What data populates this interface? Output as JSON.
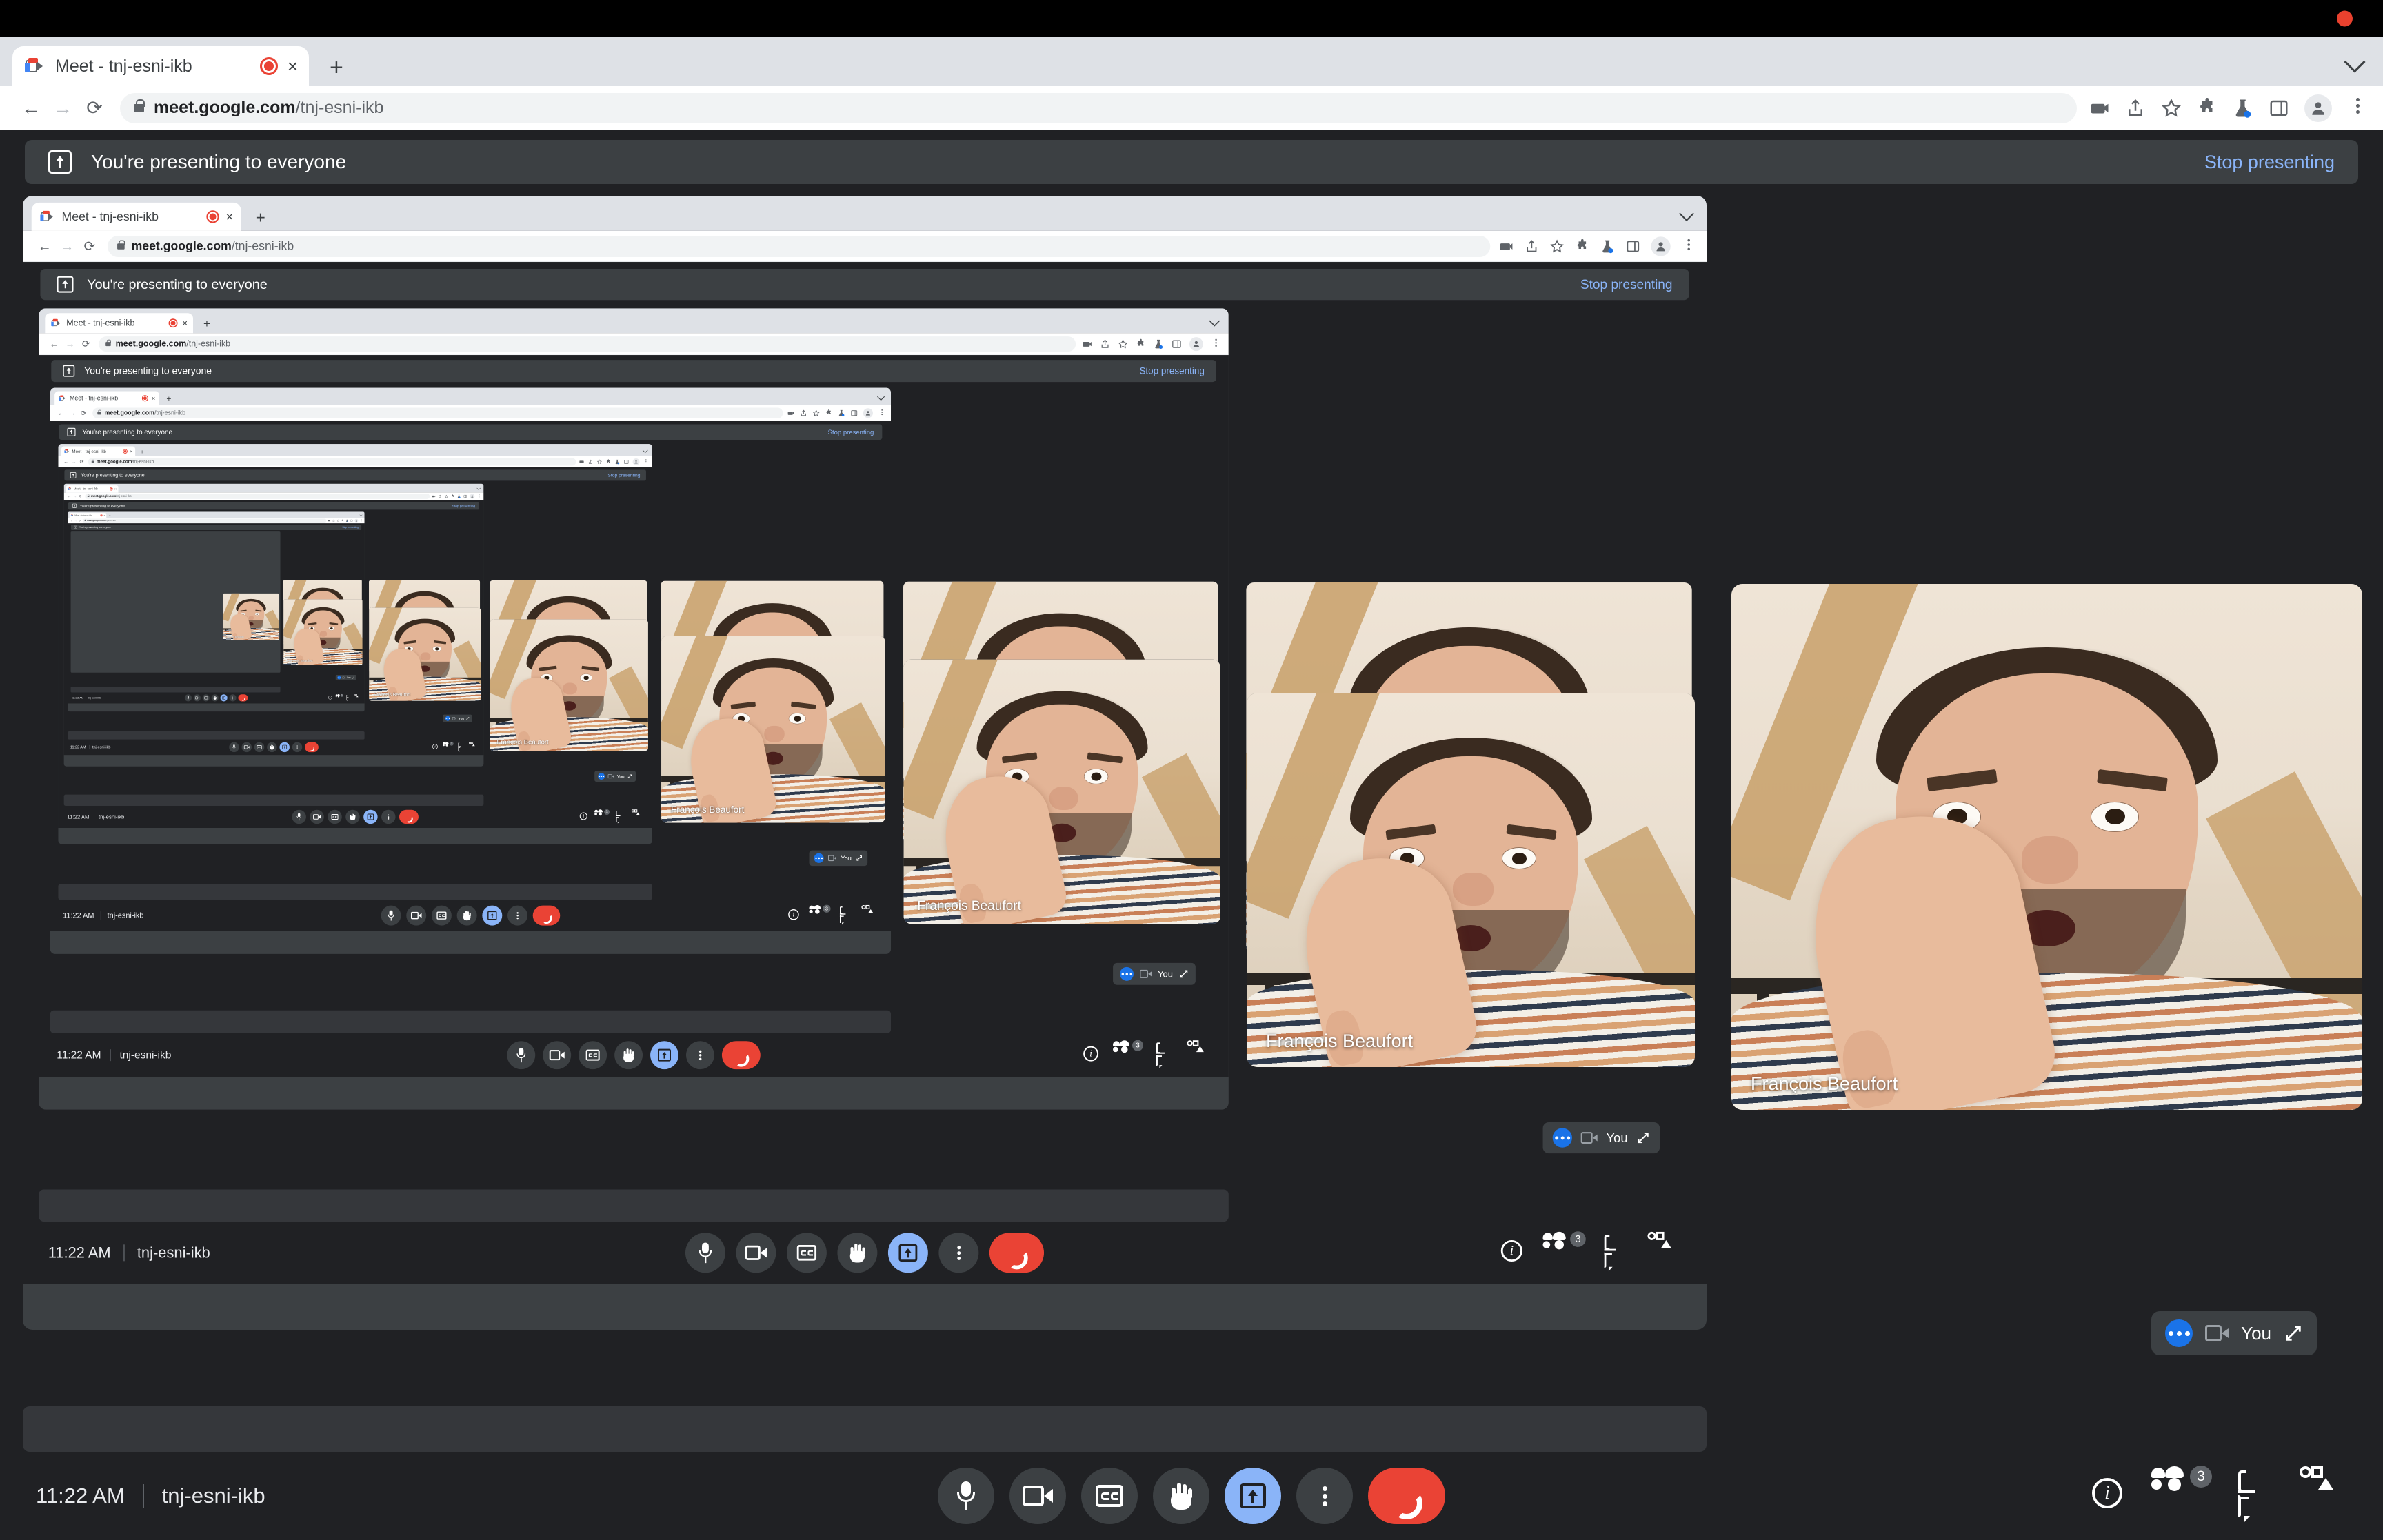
{
  "os": {
    "recording_indicator": "recording-dot",
    "accent_red": "#e8412e"
  },
  "browser": {
    "tab_title": "Meet - tnj-esni-ikb",
    "tab_recording_icon": "record-dot-icon",
    "tab_close_label": "×",
    "new_tab_label": "+",
    "favicon": "google-meet-icon",
    "back_label": "←",
    "forward_label": "→",
    "reload_label": "⟳",
    "lock_icon": "lock-icon",
    "url_domain": "meet.google.com",
    "url_path": "/tnj-esni-ikb",
    "toolbar_icons": [
      "media-cast-icon",
      "share-icon",
      "bookmark-star-icon",
      "extensions-puzzle-icon",
      "lab-flask-icon",
      "side-panel-icon",
      "profile-avatar-icon",
      "chrome-menu-icon"
    ],
    "tabstrip_chevron": "chevron-down-icon"
  },
  "meet": {
    "banner": {
      "icon": "present-screen-icon",
      "text": "You're presenting to everyone",
      "stop_label": "Stop presenting",
      "stop_color": "#8ab4f8"
    },
    "participant_name": "François Beaufort",
    "self_view": {
      "status_icon": "more-dots-icon",
      "camera_icon": "camera-icon",
      "label": "You",
      "expand_icon": "expand-icon"
    },
    "controls": {
      "time": "11:22 AM",
      "meeting_code": "tnj-esni-ikb",
      "buttons": [
        {
          "name": "microphone-button",
          "icon": "mic-icon",
          "state": "on"
        },
        {
          "name": "camera-button",
          "icon": "camera-icon",
          "state": "on"
        },
        {
          "name": "captions-button",
          "icon": "cc-icon",
          "state": "off"
        },
        {
          "name": "raise-hand-button",
          "icon": "hand-icon",
          "state": "off"
        },
        {
          "name": "present-now-button",
          "icon": "present-screen-icon",
          "state": "active"
        },
        {
          "name": "more-options-button",
          "icon": "more-vertical-icon",
          "state": "off"
        },
        {
          "name": "leave-call-button",
          "icon": "end-call-icon",
          "state": "danger"
        }
      ],
      "right_buttons": [
        {
          "name": "meeting-details-button",
          "icon": "info-icon",
          "badge": ""
        },
        {
          "name": "people-button",
          "icon": "people-icon",
          "badge": "3"
        },
        {
          "name": "chat-button",
          "icon": "chat-icon",
          "badge": ""
        },
        {
          "name": "activities-button",
          "icon": "activities-icon",
          "badge": ""
        }
      ],
      "active_color": "#8ab4f8",
      "danger_color": "#ea4335"
    }
  },
  "recursion": {
    "depth": 6,
    "note": "infinite-mirror screen share"
  }
}
